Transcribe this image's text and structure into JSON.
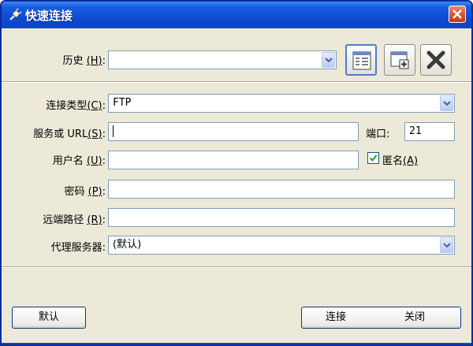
{
  "window": {
    "title": "快速连接",
    "icons": {
      "app": "quick-connect-plug-icon",
      "close": "close-x-icon"
    }
  },
  "history": {
    "label": "历史",
    "mnemonic": "(H)",
    "value": "",
    "tools": [
      "bookmark-list-icon",
      "new-window-add-icon",
      "delete-x-icon"
    ]
  },
  "fields": {
    "connection_type": {
      "label": "连接类型",
      "mnemonic": "(C)",
      "value": "FTP"
    },
    "server_url": {
      "label": "服务或 URL",
      "mnemonic": "(S)",
      "value": ""
    },
    "port": {
      "label": "端口",
      "value": "21"
    },
    "username": {
      "label": "用户名",
      "mnemonic": "(U)",
      "value": ""
    },
    "anonymous": {
      "label": "匿名",
      "mnemonic": "(A)",
      "checked": true
    },
    "password": {
      "label": "密码",
      "mnemonic": "(P)",
      "value": ""
    },
    "remote_path": {
      "label": "远端路径",
      "mnemonic": "(R)",
      "value": ""
    },
    "proxy": {
      "label": "代理服务器",
      "value": "(默认)"
    }
  },
  "buttons": {
    "default": "默认",
    "connect": "连接",
    "close": "关闭"
  },
  "colors": {
    "titlebar": "#0d4fd6",
    "dialog_bg": "#ece9d8",
    "close_button": "#d2522c",
    "input_border": "#7f9db9"
  }
}
